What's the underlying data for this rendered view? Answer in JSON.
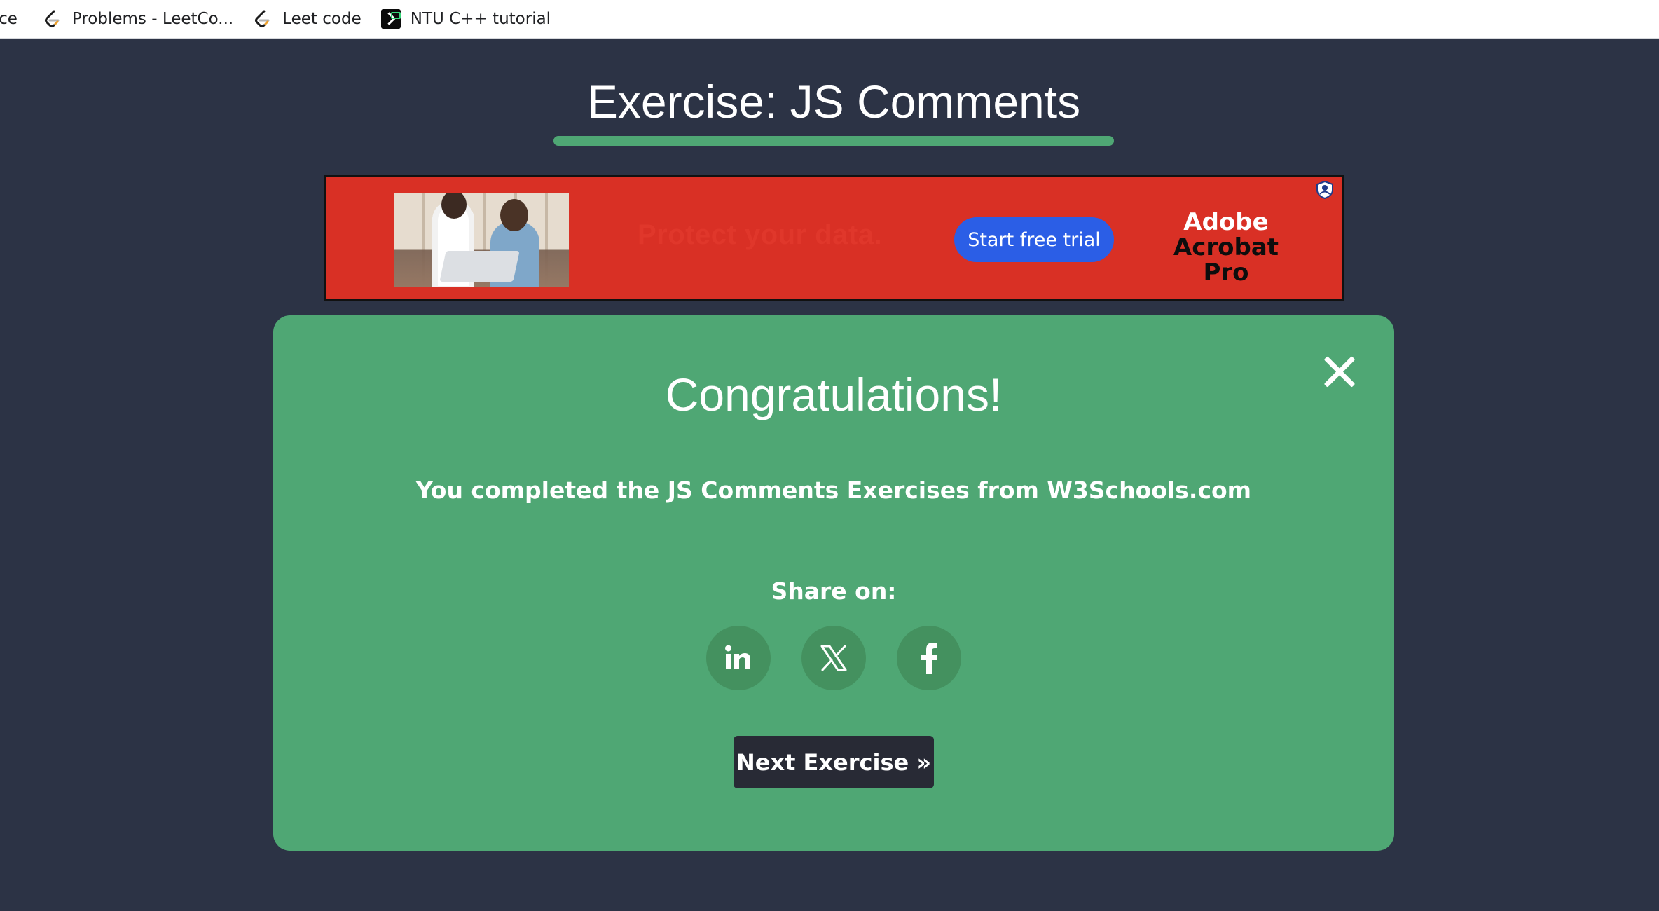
{
  "bookmarks": [
    {
      "label": "ace",
      "icon": "bookmark-icon"
    },
    {
      "label": "Problems - LeetCo...",
      "icon": "leetcode-icon"
    },
    {
      "label": "Leet code",
      "icon": "leetcode-icon"
    },
    {
      "label": "NTU C++ tutorial",
      "icon": "terminal-icon"
    }
  ],
  "page": {
    "title": "Exercise: JS Comments",
    "accent_color": "#4fa774",
    "background_color": "#2c3345"
  },
  "ad": {
    "tagline": "Protect your data.",
    "cta_label": "Start free trial",
    "brand_line1": "Adobe",
    "brand_line2": "Acrobat Pro",
    "background_color": "#d93025",
    "cta_color": "#2b5ee6"
  },
  "modal": {
    "title": "Congratulations!",
    "message": "You completed the JS Comments Exercises from W3Schools.com",
    "share_label": "Share on:",
    "share_buttons": [
      {
        "network": "LinkedIn",
        "icon": "linkedin-icon"
      },
      {
        "network": "X",
        "icon": "x-icon"
      },
      {
        "network": "Facebook",
        "icon": "facebook-icon"
      }
    ],
    "next_label": "Next Exercise »",
    "close_icon": "close-icon",
    "background_color": "#4fa774",
    "next_button_color": "#282a35"
  }
}
